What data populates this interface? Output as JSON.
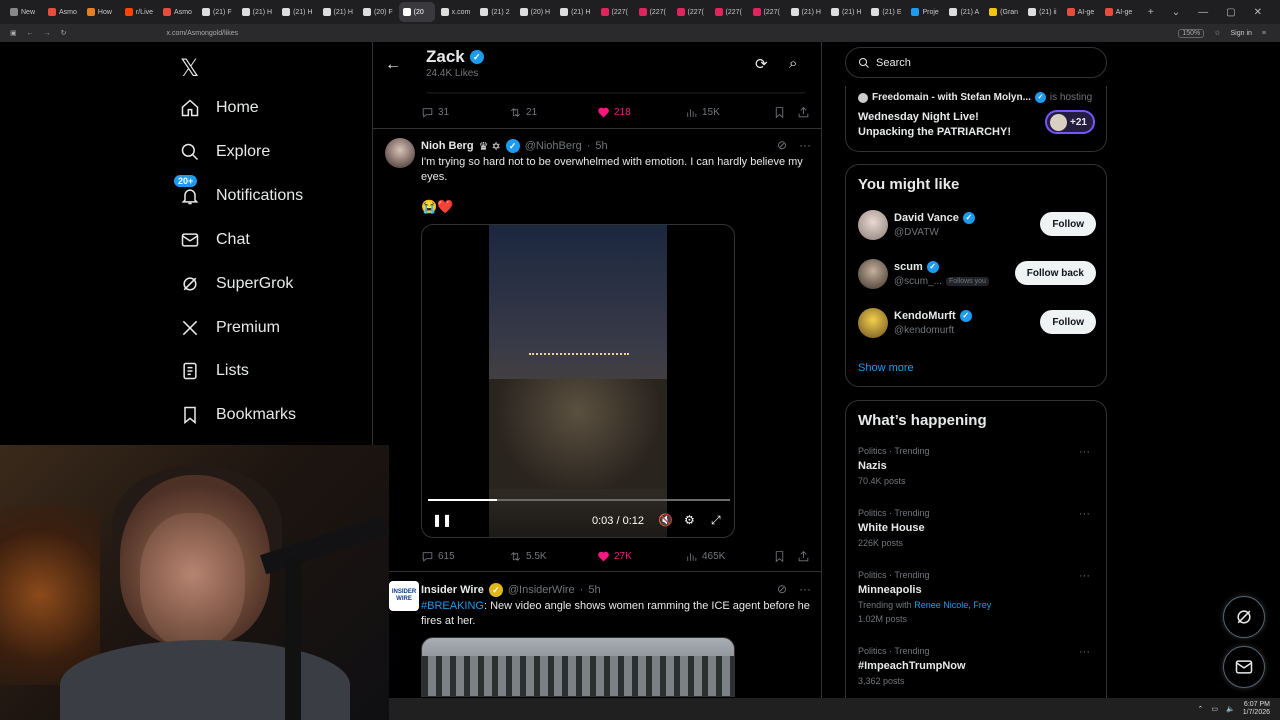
{
  "browser": {
    "tabs": [
      "New",
      "Asmo",
      "How",
      "r/Live",
      "Asmo",
      "(21) F",
      "(21) H",
      "(21) H",
      "(21) H",
      "(20) F",
      "(20",
      "x.com",
      "(21) 2",
      "(20) H",
      "(21) H",
      "(227(",
      "(227(",
      "(227(",
      "(227(",
      "(227(",
      "(21) H",
      "(21) H",
      "(21) E",
      "Proje",
      "(21) A",
      "(Gran",
      "(21) ii",
      "AI-ge",
      "AI-ge"
    ],
    "url": "x.com/Asmongold/likes",
    "zoom": "150%",
    "signin": "Sign in"
  },
  "nav": {
    "items": [
      {
        "label": "Home",
        "icon": "home-icon"
      },
      {
        "label": "Explore",
        "icon": "search-icon"
      },
      {
        "label": "Notifications",
        "icon": "bell-icon",
        "badge": "20+"
      },
      {
        "label": "Chat",
        "icon": "mail-icon"
      },
      {
        "label": "SuperGrok",
        "icon": "grok-icon"
      },
      {
        "label": "Premium",
        "icon": "x-icon"
      },
      {
        "label": "Lists",
        "icon": "list-icon"
      },
      {
        "label": "Bookmarks",
        "icon": "bookmark-icon"
      }
    ]
  },
  "profile": {
    "name": "Zack",
    "likes": "24.4K Likes"
  },
  "prev_post_actions": {
    "replies": "31",
    "reposts": "21",
    "likes": "218",
    "views": "15K"
  },
  "post1": {
    "name": "Nioh Berg",
    "badges": "♛ ✡",
    "handle": "@NiohBerg",
    "time": "5h",
    "text": "I'm trying so hard not to be overwhelmed with emotion. I can hardly believe my eyes.",
    "emoji": "😭❤️",
    "video": {
      "time": "0:03 / 0:12",
      "progress": 0.23
    },
    "actions": {
      "replies": "615",
      "reposts": "5.5K",
      "likes": "27K",
      "views": "465K"
    }
  },
  "post2": {
    "name": "Insider Wire",
    "handle": "@InsiderWire",
    "time": "5h",
    "avatar_text": "INSIDER WIRE",
    "hashtag": "#BREAKING",
    "text": ": New video angle shows women ramming the ICE agent before he fires at her."
  },
  "sidebar": {
    "search_placeholder": "Search",
    "space": {
      "host": "Freedomain - with Stefan Molyn...",
      "status": "is hosting",
      "title": "Wednesday Night Live! Unpacking the PATRIARCHY!",
      "count": "+21"
    },
    "might_like": {
      "title": "You might like",
      "users": [
        {
          "name": "David Vance",
          "handle": "@DVATW",
          "button": "Follow",
          "follows_you": ""
        },
        {
          "name": "scum",
          "handle": "@scum_...",
          "button": "Follow back",
          "follows_you": "Follows you"
        },
        {
          "name": "KendoMurft",
          "handle": "@kendomurft",
          "button": "Follow",
          "follows_you": ""
        }
      ],
      "show_more": "Show more"
    },
    "happening": {
      "title": "What’s happening",
      "trends": [
        {
          "category": "Politics · Trending",
          "name": "Nazis",
          "posts": "70.4K posts"
        },
        {
          "category": "Politics · Trending",
          "name": "White House",
          "posts": "226K posts"
        },
        {
          "category": "Politics · Trending",
          "name": "Minneapolis",
          "with_label": "Trending with",
          "with": "Renee Nicole, Frey",
          "posts": "1.02M posts"
        },
        {
          "category": "Politics · Trending",
          "name": "#ImpeachTrumpNow",
          "posts": "3,362 posts"
        }
      ]
    }
  },
  "taskbar": {
    "time": "6:07 PM",
    "date": "1/7/2026"
  }
}
